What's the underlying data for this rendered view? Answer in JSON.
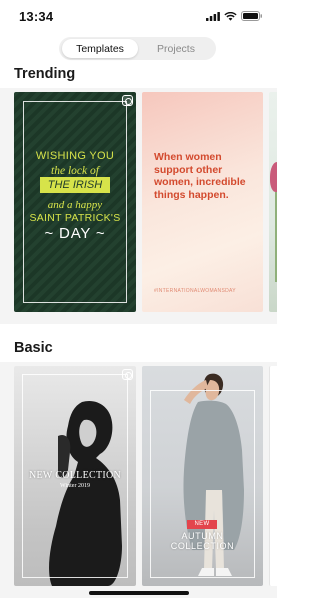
{
  "status_bar": {
    "time": "13:34",
    "icons": [
      "signal-icon",
      "wifi-icon",
      "battery-icon"
    ]
  },
  "segmented": {
    "tabs": [
      {
        "label": "Templates",
        "active": true
      },
      {
        "label": "Projects",
        "active": false
      }
    ]
  },
  "sections": {
    "trending": {
      "title": "Trending",
      "cards": [
        {
          "lines": [
            "WISHING YOU",
            "the lock of",
            "THE IRISH",
            "and a happy",
            "SAINT PATRICK'S",
            "~ DAY ~"
          ],
          "badge_icon": "instagram-icon"
        },
        {
          "quote": "When women support other women, incredible things happen.",
          "hashtag": "#INTERNATIONALWOMANSDAY"
        },
        {
          "image": "tulips"
        }
      ]
    },
    "basic": {
      "title": "Basic",
      "cards": [
        {
          "title": "NEW COLLECTION",
          "subtitle": "Winter 2019",
          "badge_icon": "instagram-icon"
        },
        {
          "badge": "NEW",
          "title_line1": "AUTUMN",
          "title_line2": "COLLECTION"
        },
        {
          "image": "blank"
        }
      ]
    }
  },
  "colors": {
    "irish_green": "#1f3b2a",
    "irish_yellow": "#d7e34a",
    "women_red": "#d34a2e",
    "badge_red": "#e3444c"
  }
}
